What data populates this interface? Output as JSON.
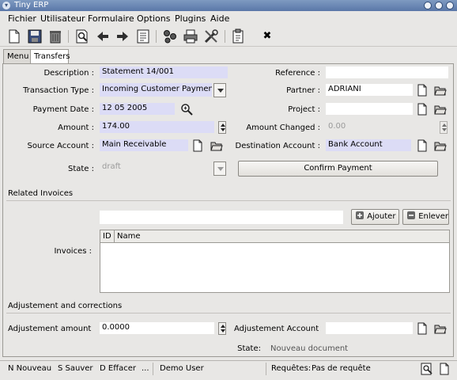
{
  "window": {
    "title": "Tiny ERP"
  },
  "menu": {
    "items": [
      "Fichier",
      "Utilisateur",
      "Formulaire",
      "Options",
      "Plugins",
      "Aide"
    ]
  },
  "toolbar": {
    "icons": [
      "new-doc-icon",
      "save-icon",
      "trash-icon",
      "search-doc-icon",
      "arrow-left-icon",
      "arrow-right-icon",
      "view-doc-icon",
      "connect-icon",
      "print-icon",
      "tools-icon",
      "attachment-icon",
      "close-icon"
    ],
    "close_glyph": "✖"
  },
  "tabs": [
    "Menu",
    "Transfers"
  ],
  "form": {
    "description": {
      "label": "Description :",
      "value": "Statement 14/001"
    },
    "reference": {
      "label": "Reference :",
      "value": ""
    },
    "transaction_type": {
      "label": "Transaction Type :",
      "value": "Incoming Customer Payment"
    },
    "partner": {
      "label": "Partner :",
      "value": "ADRIANI"
    },
    "payment_date": {
      "label": "Payment Date :",
      "value": "12 05 2005"
    },
    "project": {
      "label": "Project :",
      "value": ""
    },
    "amount": {
      "label": "Amount :",
      "value": "174.00"
    },
    "amount_changed": {
      "label": "Amount Changed :",
      "value": "0.00"
    },
    "source_account": {
      "label": "Source Account :",
      "value": "Main Receivable"
    },
    "destination_account": {
      "label": "Destination Account :",
      "value": "Bank Account"
    },
    "state": {
      "label": "State :",
      "value": "draft"
    },
    "confirm_button": "Confirm Payment"
  },
  "related_invoices": {
    "section_title": "Related Invoices",
    "invoices_label": "Invoices :",
    "add_button": "Ajouter",
    "remove_button": "Enlever",
    "columns": [
      "ID",
      "Name"
    ]
  },
  "adjustment": {
    "section_title": "Adjustement and corrections",
    "amount_label": "Adjustement amount",
    "amount_value": "0.0000",
    "account_label": "Adjustement Account",
    "account_value": "",
    "state_label": "State:",
    "state_value": "Nouveau document"
  },
  "statusbar": {
    "new": "N Nouveau",
    "save": "S Sauver",
    "delete": "D Effacer",
    "more": "...",
    "user": "Demo User",
    "requests_label": "Requêtes:",
    "requests_value": "Pas de requête"
  }
}
